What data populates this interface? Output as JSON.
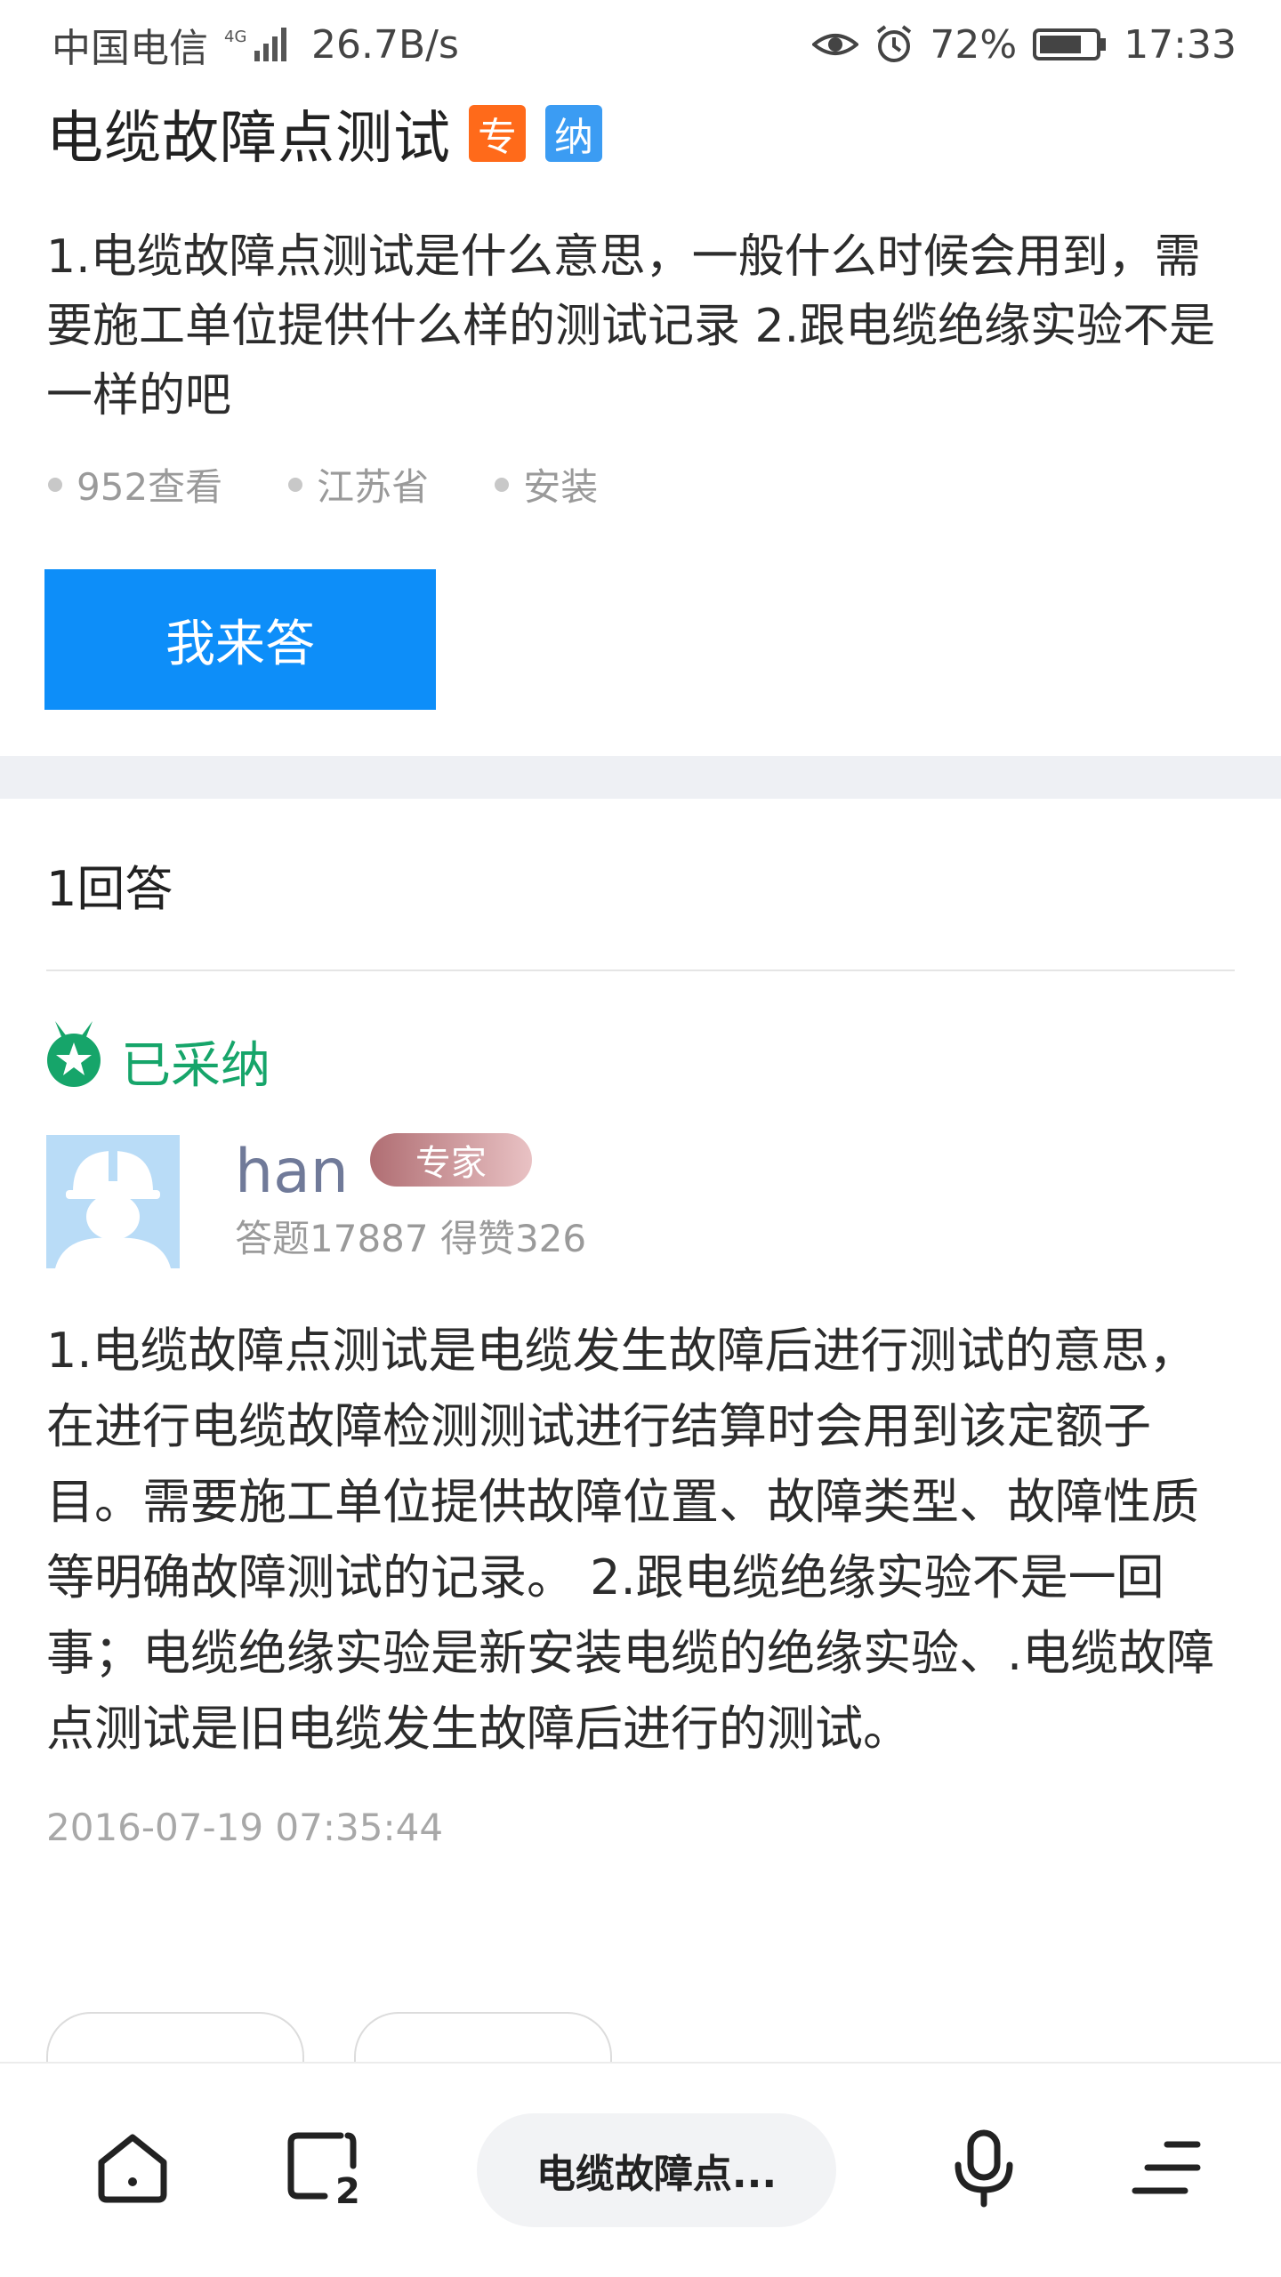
{
  "status_bar": {
    "carrier": "中国电信",
    "network": "4G",
    "speed": "26.7B/s",
    "battery": "72%",
    "time": "17:33"
  },
  "question": {
    "title": "电缆故障点测试",
    "badge_zhuan": "专",
    "badge_na": "纳",
    "content": "1.电缆故障点测试是什么意思，一般什么时候会用到，需要施工单位提供什么样的测试记录 2.跟电缆绝缘实验不是一样的吧",
    "views": "952查看",
    "region": "江苏省",
    "category": "安装",
    "answer_button": "我来答"
  },
  "answers": {
    "count_label": "1回答",
    "accepted_label": "已采纳",
    "user": {
      "name": "han",
      "badge": "专家",
      "stats": "答题17887 得赞326"
    },
    "content": "1.电缆故障点测试是电缆发生故障后进行测试的意思，在进行电缆故障检测测试进行结算时会用到该定额子目。需要施工单位提供故障位置、故障类型、故障性质等明确故障测试的记录。 2.跟电缆绝缘实验不是一回事；电缆绝缘实验是新安装电缆的绝缘实验、.电缆故障点测试是旧电缆发生故障后进行的测试。",
    "time": "2016-07-19 07:35:44"
  },
  "bottom_nav": {
    "search_text": "电缆故障点...",
    "tab_count": "2"
  },
  "colors": {
    "primary": "#0d8ef9",
    "accepted": "#16a56a",
    "badge_orange": "#ff6a1a",
    "badge_blue": "#3b9cf3"
  }
}
